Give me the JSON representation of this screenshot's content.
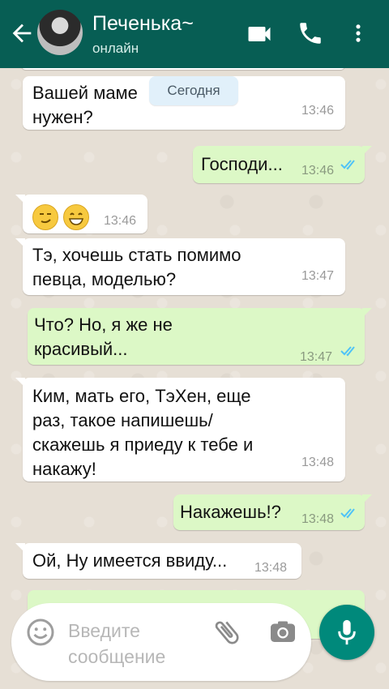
{
  "header": {
    "name": "Печенька~",
    "status": "онлайн"
  },
  "date_chip": "Сегодня",
  "messages": [
    {
      "direction": "in",
      "text": "Вашей маме нужен?",
      "time": "13:46"
    },
    {
      "direction": "out",
      "text": "Господи...",
      "time": "13:46",
      "read": true
    },
    {
      "direction": "in",
      "emoji": [
        "smirk-emoji",
        "grin-emoji"
      ],
      "time": "13:46"
    },
    {
      "direction": "in",
      "text": "Тэ, хочешь стать помимо певца, моделью?",
      "time": "13:47"
    },
    {
      "direction": "out",
      "text": "Что? Но, я же не красивый...",
      "time": "13:47",
      "read": true
    },
    {
      "direction": "in",
      "text": "Ким, мать его, ТэХен, еще раз, такое напишешь/ скажешь я приеду к тебе и накажу!",
      "time": "13:48"
    },
    {
      "direction": "out",
      "text": "Накажешь!?",
      "time": "13:48",
      "read": true
    },
    {
      "direction": "in",
      "text": "Ой, Ну имеется ввиду...",
      "time": "13:48"
    }
  ],
  "composer": {
    "placeholder": "Введите сообщение"
  },
  "colors": {
    "header": "#075e54",
    "outgoing_bubble": "#dcf8c6",
    "incoming_bubble": "#ffffff",
    "read_ticks": "#4fc3f7",
    "mic_button": "#00897b"
  }
}
